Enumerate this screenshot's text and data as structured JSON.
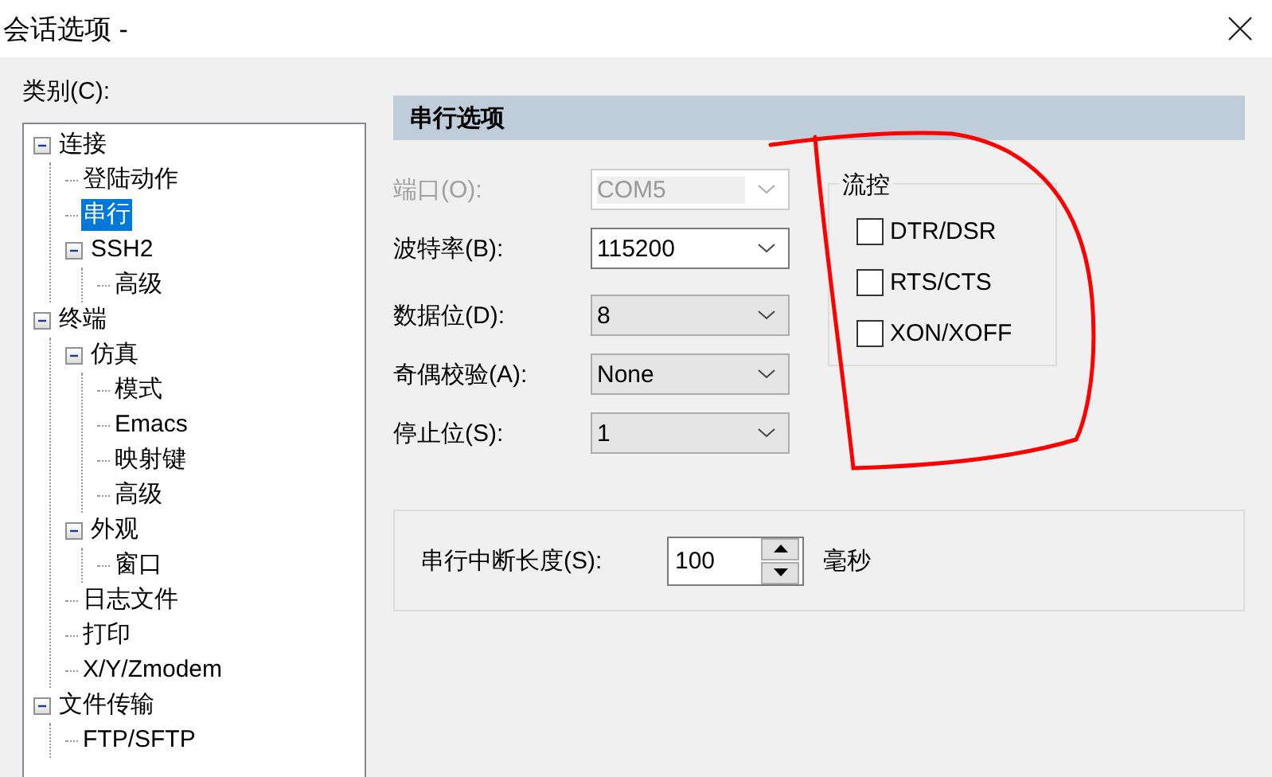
{
  "window": {
    "title": "会话选项 -"
  },
  "category_label": "类别(C):",
  "tree": [
    {
      "label": "连接",
      "expanded": true,
      "selected": false,
      "children": [
        {
          "label": "登陆动作",
          "selected": false
        },
        {
          "label": "串行",
          "selected": true
        },
        {
          "label": "SSH2",
          "expanded": true,
          "selected": false,
          "children": [
            {
              "label": "高级",
              "selected": false
            }
          ]
        }
      ]
    },
    {
      "label": "终端",
      "expanded": true,
      "selected": false,
      "children": [
        {
          "label": "仿真",
          "expanded": true,
          "selected": false,
          "children": [
            {
              "label": "模式",
              "selected": false
            },
            {
              "label": "Emacs",
              "selected": false
            },
            {
              "label": "映射键",
              "selected": false
            },
            {
              "label": "高级",
              "selected": false
            }
          ]
        },
        {
          "label": "外观",
          "expanded": true,
          "selected": false,
          "children": [
            {
              "label": "窗口",
              "selected": false
            }
          ]
        },
        {
          "label": "日志文件",
          "selected": false
        },
        {
          "label": "打印",
          "selected": false
        },
        {
          "label": "X/Y/Zmodem",
          "selected": false
        }
      ]
    },
    {
      "label": "文件传输",
      "expanded": true,
      "selected": false,
      "children": [
        {
          "label": "FTP/SFTP",
          "selected": false
        }
      ]
    }
  ],
  "panel": {
    "title": "串行选项",
    "fields": [
      {
        "label": "端口(O):",
        "value": "COM5",
        "disabled": true,
        "focused": false
      },
      {
        "label": "波特率(B):",
        "value": "115200",
        "disabled": false,
        "focused": true
      },
      {
        "label": "数据位(D):",
        "value": "8",
        "disabled": false,
        "focused": false
      },
      {
        "label": "奇偶校验(A):",
        "value": "None",
        "disabled": false,
        "focused": false
      },
      {
        "label": "停止位(S):",
        "value": "1",
        "disabled": false,
        "focused": false
      }
    ],
    "flow_control": {
      "title": "流控",
      "options": [
        {
          "label": "DTR/DSR",
          "checked": false
        },
        {
          "label": "RTS/CTS",
          "checked": false
        },
        {
          "label": "XON/XOFF",
          "checked": false
        }
      ]
    },
    "break_length": {
      "label": "串行中断长度(S):",
      "value": "100",
      "unit": "毫秒"
    }
  }
}
